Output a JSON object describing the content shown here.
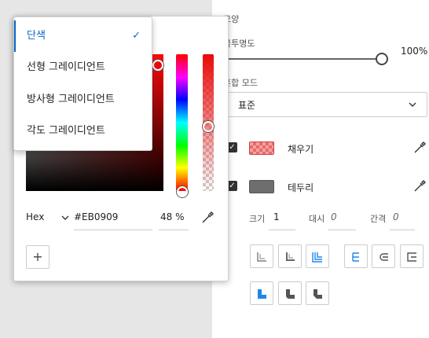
{
  "panel": {
    "shape_label": "모양",
    "opacity_label": "불투명도",
    "opacity_value": "100%",
    "opacity_fraction": 1.0,
    "blend_label": "혼합 모드",
    "blend_value": "표준",
    "fill_label": "채우기",
    "stroke_label": "테두리",
    "size_label": "크기",
    "size_value": "1",
    "dash_label": "대시",
    "dash_value": "0",
    "gap_label": "간격",
    "gap_value": "0",
    "stroke_color": "#6e6e6e",
    "accent_color": "#1e88e5"
  },
  "popup": {
    "format_label": "Hex",
    "hex_value": "#EB0909",
    "alpha_value": "48 %",
    "add_label": "+",
    "current_color": "#EB0909",
    "alpha_fraction": 0.48
  },
  "menu": {
    "items": [
      "단색",
      "선형 그레이디언트",
      "방사형 그레이디언트",
      "각도 그레이디언트"
    ],
    "selected_index": 0,
    "check_glyph": "✓"
  }
}
